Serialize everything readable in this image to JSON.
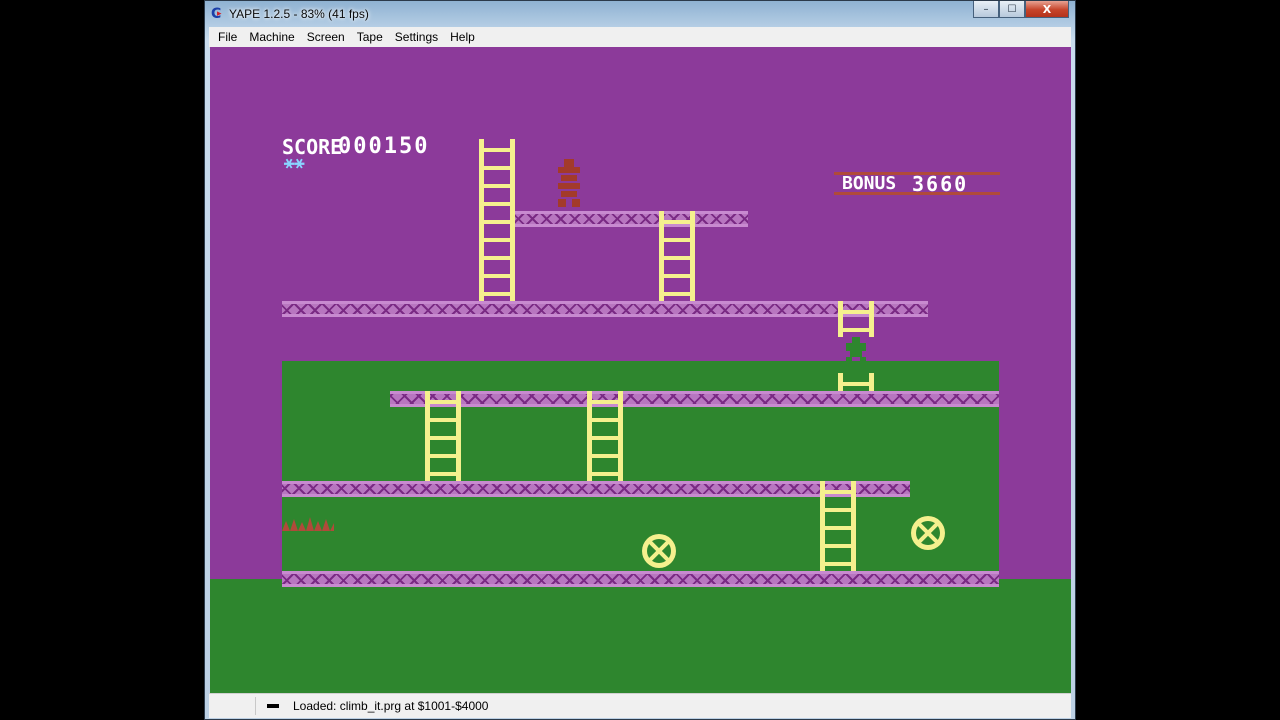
{
  "window": {
    "title": "YAPE 1.2.5 - 83% (41 fps)",
    "buttons": {
      "minimize": "–",
      "maximize": "☐",
      "close": "X"
    }
  },
  "menu": [
    "File",
    "Machine",
    "Screen",
    "Tape",
    "Settings",
    "Help"
  ],
  "game": {
    "score_label": "SCORE",
    "score_value": "000150",
    "bonus_label": "BONUS",
    "bonus_value": "3660",
    "lives": 2,
    "colors": {
      "background": "#8c3a9a",
      "ground": "#2e862e",
      "girder": "#b876c0",
      "ladder": "#f5f08e",
      "text": "#ffffff"
    },
    "icons": [
      "gorilla-icon",
      "barrel-icon",
      "player-icon",
      "fire-icon",
      "life-icon"
    ]
  },
  "status": {
    "message": "Loaded: climb_it.prg at $1001-$4000"
  }
}
